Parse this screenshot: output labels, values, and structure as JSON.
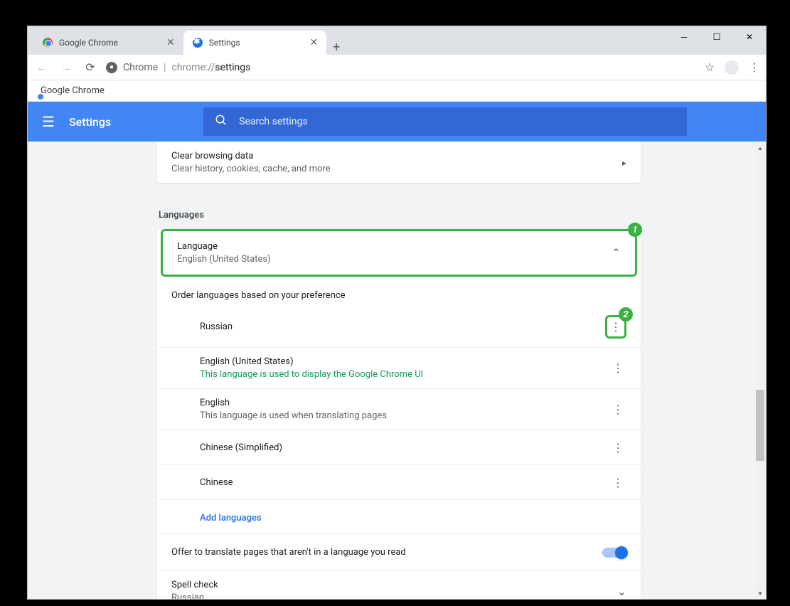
{
  "window": {
    "tabs": [
      {
        "title": "Google Chrome"
      },
      {
        "title": "Settings"
      }
    ]
  },
  "addressbar": {
    "prefix": "Chrome",
    "url_gray": "chrome://",
    "url_bold": "settings"
  },
  "bookmarks": {
    "item": "Google Chrome"
  },
  "header": {
    "title": "Settings",
    "search_placeholder": "Search settings"
  },
  "clear_data": {
    "title": "Clear browsing data",
    "subtitle": "Clear history, cookies, cache, and more"
  },
  "languages": {
    "section": "Languages",
    "header_title": "Language",
    "header_sub": "English (United States)",
    "order_hint": "Order languages based on your preference",
    "badge1": "1",
    "badge2": "2",
    "items": [
      {
        "name": "Russian",
        "sub": "",
        "sub_class": ""
      },
      {
        "name": "English (United States)",
        "sub": "This language is used to display the Google Chrome UI",
        "sub_class": "green"
      },
      {
        "name": "English",
        "sub": "This language is used when translating pages",
        "sub_class": "gray"
      },
      {
        "name": "Chinese (Simplified)",
        "sub": "",
        "sub_class": ""
      },
      {
        "name": "Chinese",
        "sub": "",
        "sub_class": ""
      }
    ],
    "add": "Add languages",
    "translate": "Offer to translate pages that aren't in a language you read",
    "spell_title": "Spell check",
    "spell_sub": "Russian"
  }
}
